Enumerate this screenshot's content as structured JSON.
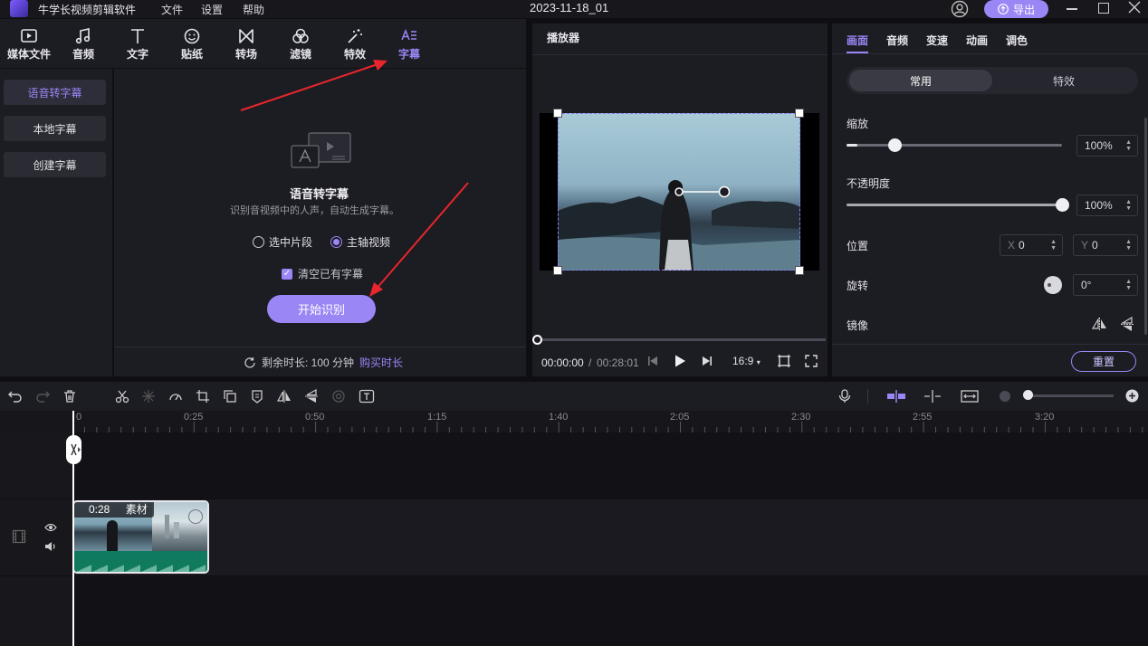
{
  "app": {
    "name": "牛学长视频剪辑软件",
    "doc_title": "2023-11-18_01",
    "export_label": "导出"
  },
  "menu": [
    "文件",
    "设置",
    "帮助"
  ],
  "tools": [
    "媒体文件",
    "音频",
    "文字",
    "贴纸",
    "转场",
    "滤镜",
    "特效",
    "字幕"
  ],
  "subtitle_nav": [
    "语音转字幕",
    "本地字幕",
    "创建字幕"
  ],
  "speech_panel": {
    "title": "语音转字幕",
    "desc": "识别音视频中的人声，自动生成字幕。",
    "option_selected_clip": "选中片段",
    "option_main_video": "主轴视频",
    "clear_existing": "清空已有字幕",
    "start_button": "开始识别",
    "remaining_label": "剩余时长: 100 分钟",
    "buy_link": "购买时长"
  },
  "player": {
    "title": "播放器",
    "current_time": "00:00:00",
    "separator": "/",
    "total_time": "00:28:01",
    "aspect": "16:9"
  },
  "props": {
    "tabs": [
      "画面",
      "音频",
      "变速",
      "动画",
      "调色"
    ],
    "segments": [
      "常用",
      "特效"
    ],
    "scale_label": "缩放",
    "scale_value": "100%",
    "scale_level": 0.05,
    "opacity_label": "不透明度",
    "opacity_value": "100%",
    "opacity_level": 1.0,
    "position_label": "位置",
    "pos_x_label": "X",
    "pos_x": "0",
    "pos_y_label": "Y",
    "pos_y": "0",
    "rotation_label": "旋转",
    "rotation_value": "0°",
    "mirror_label": "镜像",
    "reset_label": "重置"
  },
  "timeline": {
    "ruler": [
      "0",
      "0:25",
      "0:50",
      "1:15",
      "1:40",
      "2:05",
      "2:30",
      "2:55",
      "3:20"
    ],
    "clip_duration": "0:28",
    "clip_label": "素材"
  },
  "colors": {
    "accent": "#9a86f5",
    "arrow": "#e8262b"
  }
}
